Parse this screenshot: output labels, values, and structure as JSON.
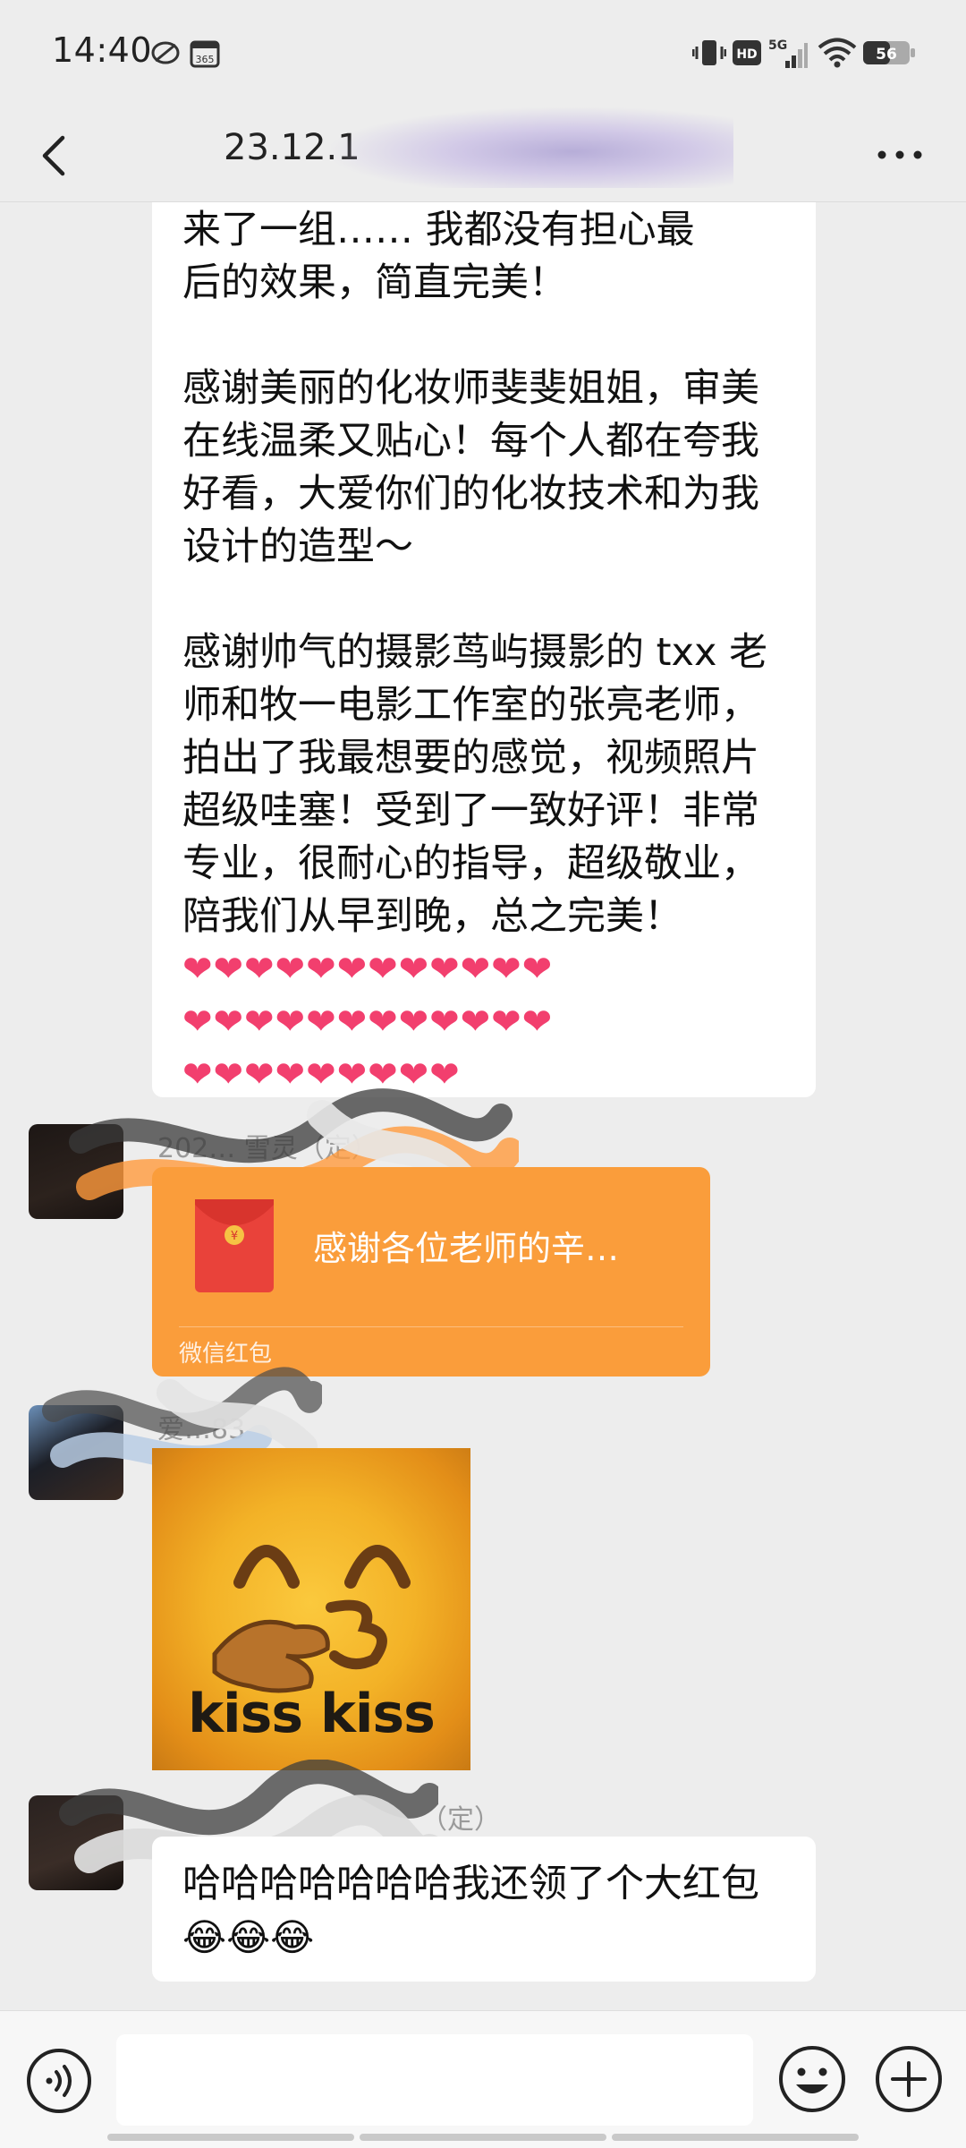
{
  "status_bar": {
    "time": "14:40",
    "network": "5G",
    "battery": "56",
    "hd_label": "HD",
    "calendar_label": "365"
  },
  "header": {
    "title": "23.12.1"
  },
  "messages": {
    "long_text": {
      "line_1": "来了一组…… 我都没有担心最",
      "line_2": "后的效果，简直完美！",
      "paragraph_2": "感谢美丽的化妆师斐斐姐姐，审美在线温柔又贴心！每个人都在夸我好看，大爱你们的化妆技术和为我设计的造型～",
      "paragraph_3": "感谢帅气的摄影茑屿摄影的 txx 老师和牧一电影工作室的张亮老师，拍出了我最想要的感觉，视频照片超级哇塞！受到了一致好评！非常专业，很耐心的指导，超级敬业，陪我们从早到晚，总之完美！",
      "hearts_row_1": "❤❤❤❤❤❤❤❤❤❤❤❤",
      "hearts_row_2": "❤❤❤❤❤❤❤❤❤❤❤❤",
      "hearts_row_3": "❤❤❤❤❤❤❤❤❤"
    },
    "red_packet": {
      "sender": "202… 雪灵（定）",
      "title": "感谢各位老师的辛…",
      "footer": "微信红包"
    },
    "sticker": {
      "sender": "爱…83",
      "caption": "kiss kiss"
    },
    "last": {
      "sender": "（定）",
      "text": "哈哈哈哈哈哈哈我还领了个大红包",
      "emojis": "😂😂😂"
    }
  },
  "input": {
    "placeholder": ""
  },
  "colors": {
    "background": "#ededed",
    "bubble": "#ffffff",
    "red_packet": "#fa9d3b",
    "heart": "#f23f6e"
  },
  "icons": [
    "back-icon",
    "more-icon",
    "voice-icon",
    "emoji-icon",
    "plus-icon",
    "red-envelope-icon",
    "wifi-icon",
    "signal-icon",
    "battery-icon",
    "vibrate-icon",
    "calendar-icon"
  ]
}
